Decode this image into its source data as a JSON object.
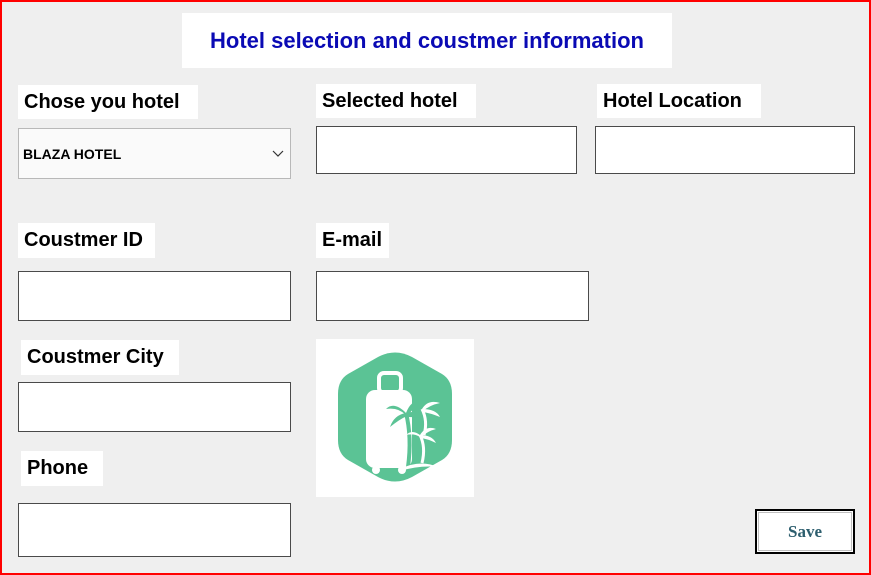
{
  "window": {
    "title": "Hotel selection and coustmer information"
  },
  "labels": {
    "choose_hotel": "Chose you hotel",
    "selected_hotel": "Selected hotel",
    "hotel_location": "Hotel Location",
    "customer_id": "Coustmer ID",
    "email": "E-mail",
    "customer_city": "Coustmer City",
    "phone": "Phone"
  },
  "hotel_select": {
    "selected_value": "BLAZA HOTEL",
    "icon": "chevron-down-icon"
  },
  "fields": {
    "selected_hotel": "",
    "hotel_location": "",
    "customer_id": "",
    "email": "",
    "customer_city": "",
    "phone": ""
  },
  "logo": {
    "icon": "luggage-palm-tree-logo",
    "color": "#5bc395"
  },
  "actions": {
    "save_label": "Save"
  },
  "colors": {
    "window_border": "#ff0000",
    "title_text": "#0a0ab4",
    "background": "#efefef",
    "save_text": "#2d5e6e"
  }
}
